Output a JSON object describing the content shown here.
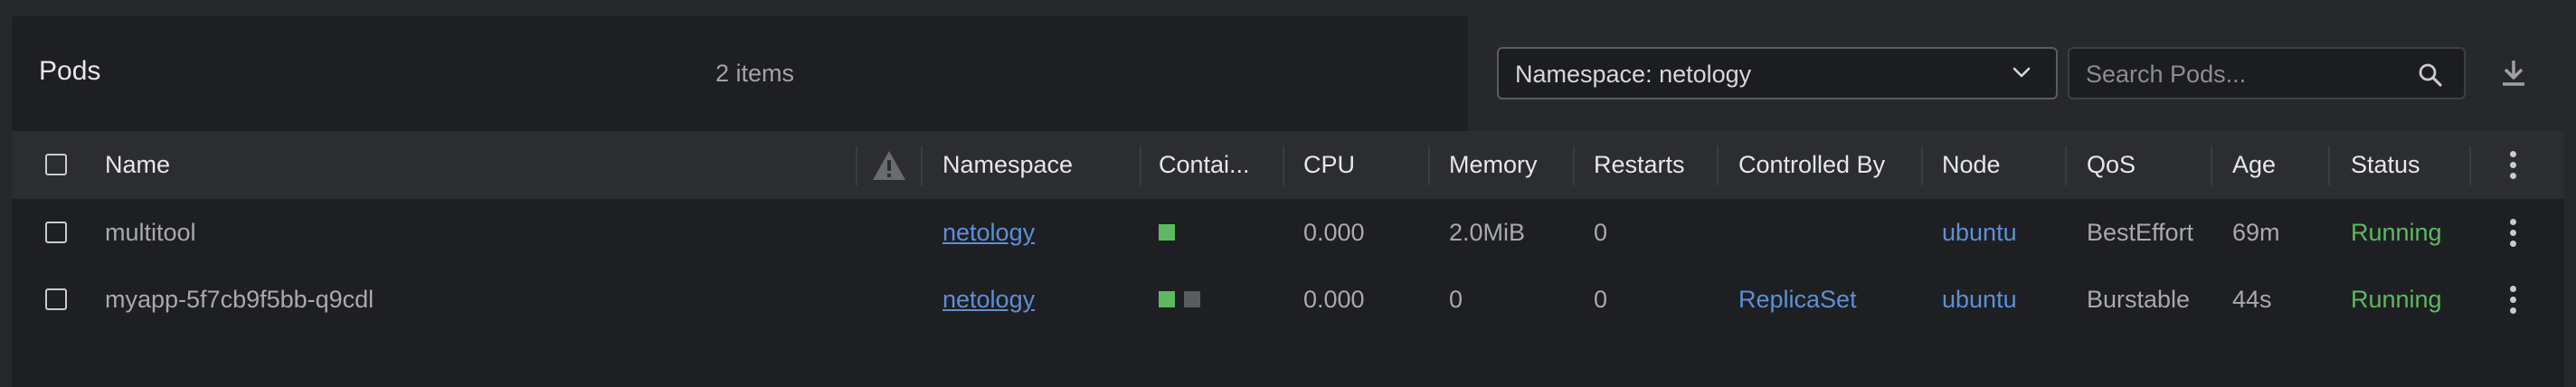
{
  "header": {
    "title": "Pods",
    "count": "2 items",
    "namespace_select": "Namespace: netology",
    "search_placeholder": "Search Pods..."
  },
  "columns": {
    "name": "Name",
    "namespace": "Namespace",
    "containers": "Contai...",
    "cpu": "CPU",
    "memory": "Memory",
    "restarts": "Restarts",
    "controlled_by": "Controlled By",
    "node": "Node",
    "qos": "QoS",
    "age": "Age",
    "status": "Status"
  },
  "rows": [
    {
      "name": "multitool",
      "namespace": "netology",
      "containers": [
        "running"
      ],
      "cpu": "0.000",
      "memory": "2.0MiB",
      "restarts": "0",
      "controlled_by": "",
      "node": "ubuntu",
      "qos": "BestEffort",
      "age": "69m",
      "status": "Running"
    },
    {
      "name": "myapp-5f7cb9f5bb-q9cdl",
      "namespace": "netology",
      "containers": [
        "running",
        "waiting"
      ],
      "cpu": "0.000",
      "memory": "0",
      "restarts": "0",
      "controlled_by": "ReplicaSet",
      "node": "ubuntu",
      "qos": "Burstable",
      "age": "44s",
      "status": "Running"
    }
  ],
  "colors": {
    "link": "#5d8fd6",
    "running": "#5cb95f",
    "container_running": "#5cb95f",
    "container_waiting": "#5a5b60"
  }
}
